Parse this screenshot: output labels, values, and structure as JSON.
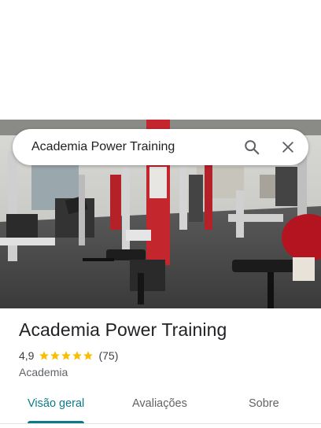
{
  "search": {
    "query": "Academia Power Training"
  },
  "place": {
    "name": "Academia Power Training",
    "rating": "4,9",
    "stars": 5,
    "review_count": "(75)",
    "category": "Academia"
  },
  "tabs": [
    {
      "label": "Visão geral",
      "active": true
    },
    {
      "label": "Avaliações",
      "active": false
    },
    {
      "label": "Sobre",
      "active": false
    }
  ],
  "colors": {
    "accent": "#0b7a8c",
    "star": "#fbbc04"
  }
}
